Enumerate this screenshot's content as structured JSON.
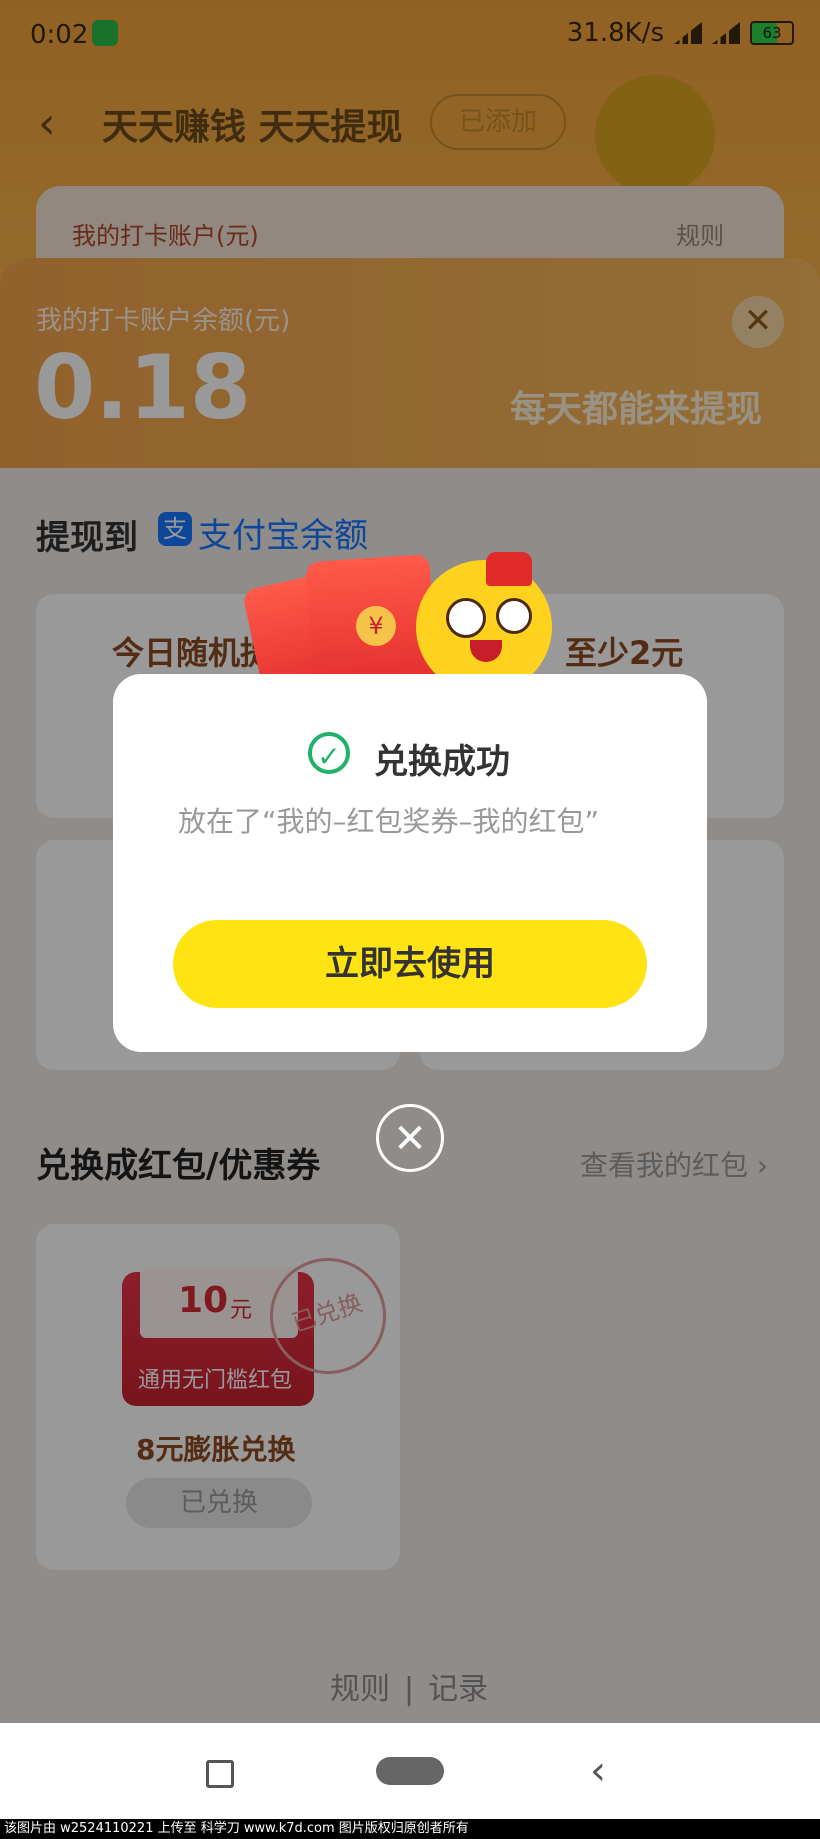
{
  "status_bar": {
    "time": "0:02",
    "speed": "31.8K/s",
    "battery": "63"
  },
  "header": {
    "title": "天天赚钱 天天提现",
    "added_label": "已添加"
  },
  "account_card": {
    "title": "我的打卡账户(元)",
    "rules": "规则"
  },
  "sheet": {
    "balance_label": "我的打卡账户余额(元)",
    "balance_amount": "0.18",
    "slogan": "每天都能来提现",
    "close_icon": "close-icon"
  },
  "withdraw": {
    "label": "提现到",
    "method": "支付宝余额",
    "option1_left": "今日随机提",
    "option1_right": "至少2元"
  },
  "exchange": {
    "title": "兑换成红包/优惠券",
    "view_link": "查看我的红包",
    "coupon": {
      "value": "10",
      "unit": "元",
      "desc": "通用无门槛红包",
      "stamp": "已兑换",
      "price_label": "8元膨胀兑换",
      "button": "已兑换"
    }
  },
  "footer": {
    "rules": "规则",
    "records": "记录"
  },
  "modal": {
    "title": "兑换成功",
    "message": "放在了“我的–红包奖券–我的红包”",
    "button": "立即去使用",
    "coin_symbol": "¥",
    "close_symbol": "✕"
  },
  "watermark": "该图片由 w2524110221 上传至 科学刀 www.k7d.com 图片版权归原创者所有",
  "colors": {
    "accent": "#ffe312",
    "orange": "#f2a34a",
    "success": "#20b26a",
    "alipay": "#1677ff"
  }
}
